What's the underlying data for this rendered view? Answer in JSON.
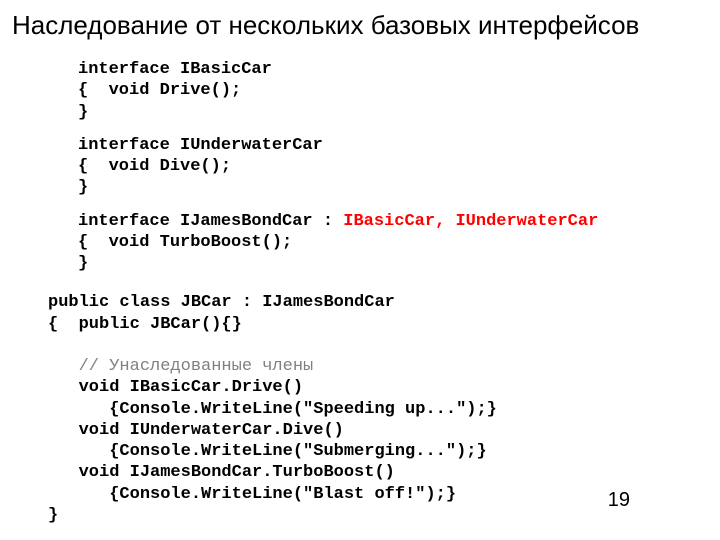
{
  "title": "Наследование от нескольких базовых интерфейсов",
  "code": {
    "iface1_l1": "interface IBasicCar",
    "iface1_l2": "{  void Drive();",
    "iface1_l3": "}",
    "iface2_l1": "interface IUnderwaterCar",
    "iface2_l2": "{  void Dive();",
    "iface2_l3": "}",
    "iface3_l1a": "interface IJamesBondCar : ",
    "iface3_l1b": "IBasicCar, IUnderwaterCar",
    "iface3_l2": "{  void TurboBoost();",
    "iface3_l3": "}",
    "cls_l1": "public class JBCar : IJamesBondCar",
    "cls_l2": "{  public JBCar(){}",
    "cls_blank": "",
    "cls_comment": "   // Унаследованные члены",
    "cls_m1a": "   void IBasicCar.Drive()",
    "cls_m1b": "      {Console.WriteLine(\"Speeding up...\");}",
    "cls_m2a": "   void IUnderwaterCar.Dive()",
    "cls_m2b": "      {Console.WriteLine(\"Submerging...\");}",
    "cls_m3a": "   void IJamesBondCar.TurboBoost()",
    "cls_m3b": "      {Console.WriteLine(\"Blast off!\");}",
    "cls_close": "}"
  },
  "page_number": "19"
}
